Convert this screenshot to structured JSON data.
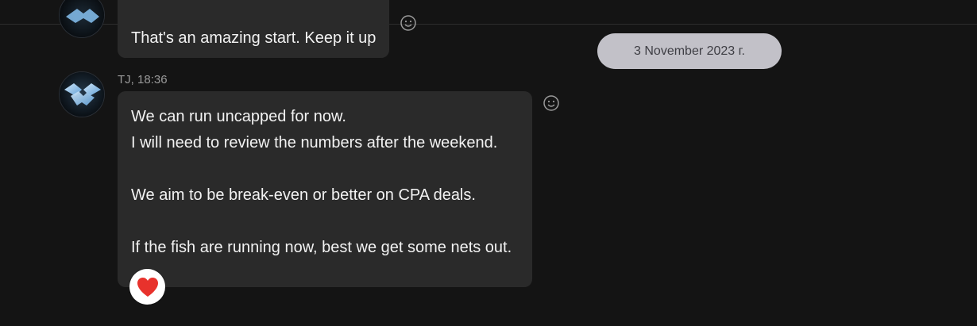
{
  "colors": {
    "background": "#141414",
    "bubble": "#2a2a2a",
    "message_text": "#f2f2f2",
    "meta_text": "#9a9a9a",
    "date_pill_bg": "#c2c1c8",
    "date_pill_text": "#3e3e44",
    "reaction_heart": "#e8322c",
    "avatar_accent": "#7fb8e6"
  },
  "previous_message": {
    "text": "That's an amazing start. Keep it up",
    "react_icon": "smiley-icon"
  },
  "message": {
    "sender": "TJ",
    "time": "18:36",
    "meta": "TJ, 18:36",
    "lines": [
      "We can run uncapped for now.",
      "I will need to review the numbers after the weekend.",
      "",
      "We aim to be break-even or better on CPA deals.",
      "",
      "If the fish are running now, best we get some nets out."
    ],
    "react_icon": "smiley-icon",
    "reaction": {
      "icon": "heart-icon"
    }
  },
  "date_separator": {
    "label": "3 November 2023 г."
  }
}
